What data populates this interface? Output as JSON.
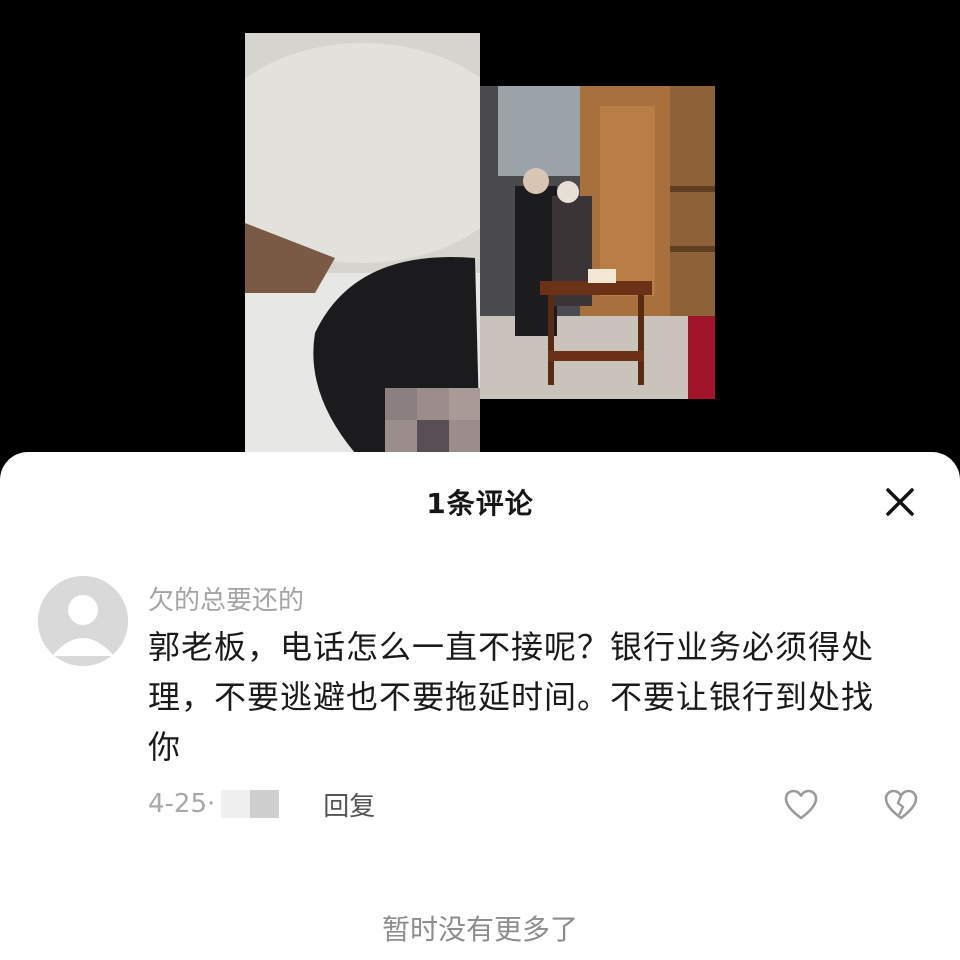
{
  "sheet": {
    "title": "1条评论",
    "close_icon": "close-icon",
    "footer": "暂时没有更多了"
  },
  "comment": {
    "username": "欠的总要还的",
    "text": "郭老板，电话怎么一直不接呢？银行业务必须得处理，不要逃避也不要拖延时间。不要让银行到处找你",
    "date": "4-25",
    "separator": "·",
    "reply_label": "回复",
    "avatar_icon": "default-avatar-icon",
    "like_icon": "heart-icon",
    "dislike_icon": "broken-heart-icon"
  },
  "colors": {
    "backdrop": "#000000",
    "sheet_bg": "#ffffff",
    "username": "#a4a4a4",
    "text": "#1a1a1a",
    "muted": "#a8a8a8"
  }
}
